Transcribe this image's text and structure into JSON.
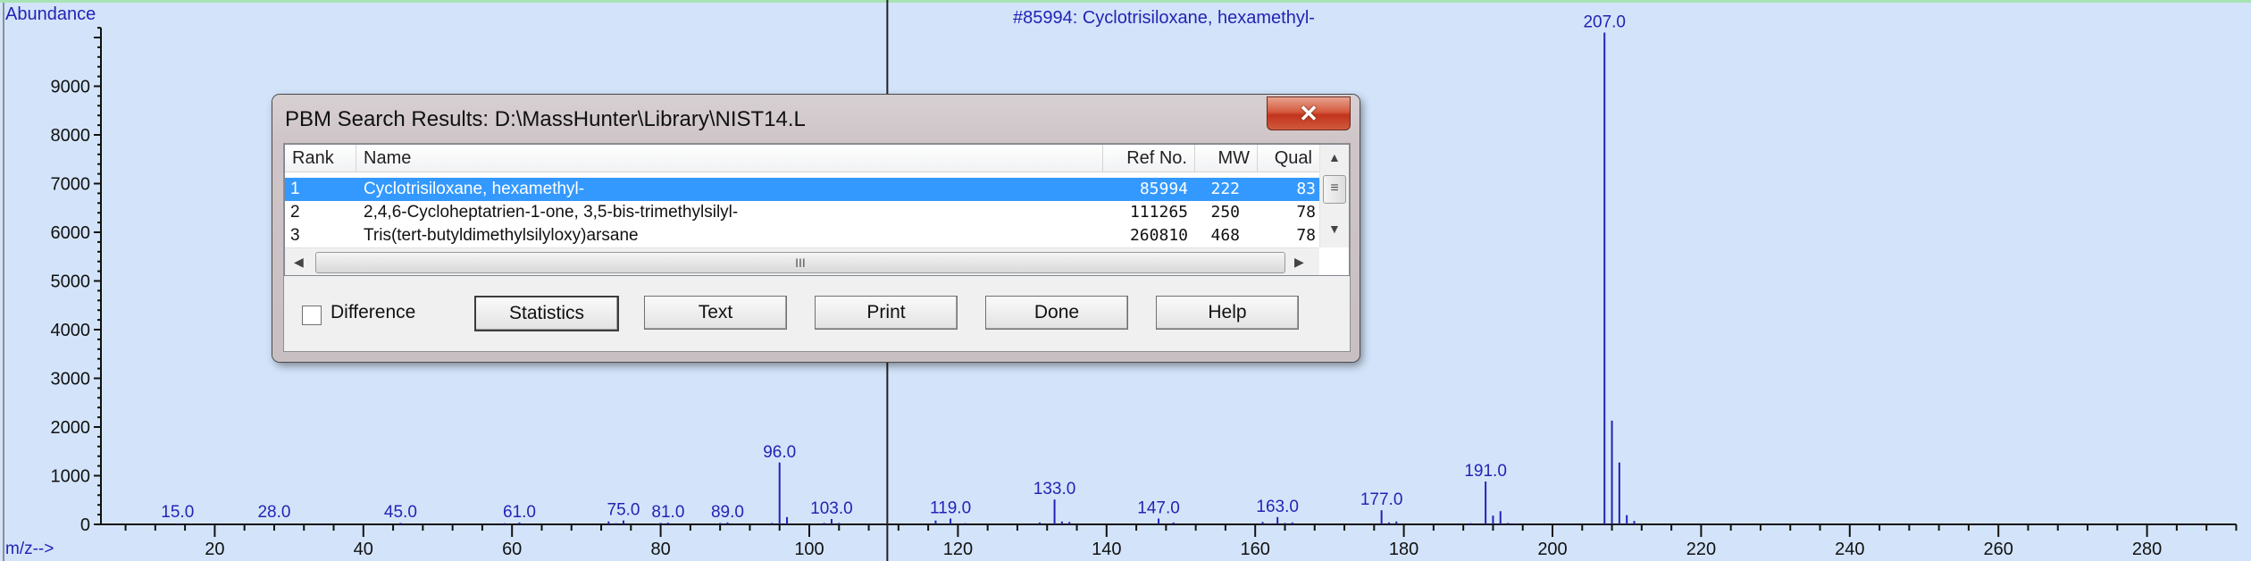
{
  "chart_data": {
    "type": "bar",
    "title": "#85994: Cyclotrisiloxane, hexamethyl-",
    "ylabel": "Abundance",
    "xlabel": "m/z-->",
    "xlim": [
      5,
      292
    ],
    "ylim": [
      0,
      10200
    ],
    "xticks": [
      20,
      40,
      60,
      80,
      100,
      120,
      140,
      160,
      180,
      200,
      220,
      240,
      260,
      280
    ],
    "yticks": [
      0,
      1000,
      2000,
      3000,
      4000,
      5000,
      6000,
      7000,
      8000,
      9000
    ],
    "cursor_mz": 110.5,
    "peaks": [
      {
        "mz": 15,
        "abundance": 20
      },
      {
        "mz": 28,
        "abundance": 15
      },
      {
        "mz": 45,
        "abundance": 30
      },
      {
        "mz": 59,
        "abundance": 25
      },
      {
        "mz": 61,
        "abundance": 40
      },
      {
        "mz": 73,
        "abundance": 60
      },
      {
        "mz": 74,
        "abundance": 25
      },
      {
        "mz": 75,
        "abundance": 80
      },
      {
        "mz": 80,
        "abundance": 30
      },
      {
        "mz": 81,
        "abundance": 35
      },
      {
        "mz": 88,
        "abundance": 30
      },
      {
        "mz": 89,
        "abundance": 40
      },
      {
        "mz": 95,
        "abundance": 30
      },
      {
        "mz": 96,
        "abundance": 1270
      },
      {
        "mz": 97,
        "abundance": 150
      },
      {
        "mz": 102,
        "abundance": 30
      },
      {
        "mz": 103,
        "abundance": 110
      },
      {
        "mz": 104,
        "abundance": 30
      },
      {
        "mz": 117,
        "abundance": 80
      },
      {
        "mz": 119,
        "abundance": 120
      },
      {
        "mz": 121,
        "abundance": 25
      },
      {
        "mz": 131,
        "abundance": 40
      },
      {
        "mz": 133,
        "abundance": 510
      },
      {
        "mz": 134,
        "abundance": 60
      },
      {
        "mz": 135,
        "abundance": 50
      },
      {
        "mz": 147,
        "abundance": 120
      },
      {
        "mz": 149,
        "abundance": 40
      },
      {
        "mz": 161,
        "abundance": 50
      },
      {
        "mz": 162,
        "abundance": 20
      },
      {
        "mz": 163,
        "abundance": 150
      },
      {
        "mz": 164,
        "abundance": 30
      },
      {
        "mz": 165,
        "abundance": 40
      },
      {
        "mz": 177,
        "abundance": 290
      },
      {
        "mz": 178,
        "abundance": 40
      },
      {
        "mz": 179,
        "abundance": 60
      },
      {
        "mz": 189,
        "abundance": 25
      },
      {
        "mz": 191,
        "abundance": 880
      },
      {
        "mz": 192,
        "abundance": 180
      },
      {
        "mz": 193,
        "abundance": 270
      },
      {
        "mz": 194,
        "abundance": 30
      },
      {
        "mz": 195,
        "abundance": 20
      },
      {
        "mz": 207,
        "abundance": 10100
      },
      {
        "mz": 208,
        "abundance": 2130
      },
      {
        "mz": 209,
        "abundance": 1270
      },
      {
        "mz": 210,
        "abundance": 190
      },
      {
        "mz": 211,
        "abundance": 70
      }
    ],
    "peak_labels": [
      {
        "mz": 15,
        "text": "15.0"
      },
      {
        "mz": 28,
        "text": "28.0"
      },
      {
        "mz": 45,
        "text": "45.0"
      },
      {
        "mz": 61,
        "text": "61.0"
      },
      {
        "mz": 75,
        "text": "75.0"
      },
      {
        "mz": 81,
        "text": "81.0"
      },
      {
        "mz": 89,
        "text": "89.0"
      },
      {
        "mz": 96,
        "text": "96.0"
      },
      {
        "mz": 103,
        "text": "103.0"
      },
      {
        "mz": 119,
        "text": "119.0"
      },
      {
        "mz": 133,
        "text": "133.0"
      },
      {
        "mz": 147,
        "text": "147.0"
      },
      {
        "mz": 163,
        "text": "163.0"
      },
      {
        "mz": 177,
        "text": "177.0"
      },
      {
        "mz": 191,
        "text": "191.0"
      },
      {
        "mz": 207,
        "text": "207.0"
      }
    ],
    "colors": {
      "peak": "#2323b4",
      "axis": "#111111",
      "background": "#d3e4fa"
    }
  },
  "dialog": {
    "title": "PBM Search Results: D:\\MassHunter\\Library\\NIST14.L",
    "close_glyph": "✕",
    "columns": [
      "Rank",
      "Name",
      "Ref No.",
      "MW",
      "Qual"
    ],
    "rows": [
      {
        "rank": "1",
        "name": "Cyclotrisiloxane, hexamethyl-",
        "ref": "85994",
        "mw": "222",
        "qual": "83",
        "selected": true
      },
      {
        "rank": "2",
        "name": "2,4,6-Cycloheptatrien-1-one, 3,5-bis-trimethylsilyl-",
        "ref": "111265",
        "mw": "250",
        "qual": "78"
      },
      {
        "rank": "3",
        "name": "Tris(tert-butyldimethylsilyloxy)arsane",
        "ref": "260810",
        "mw": "468",
        "qual": "78"
      }
    ],
    "difference_label": "Difference",
    "difference_checked": false,
    "buttons": {
      "statistics": "Statistics",
      "text": "Text",
      "print": "Print",
      "done": "Done",
      "help": "Help"
    },
    "scroll": {
      "up": "▲",
      "down": "▼",
      "left": "◀",
      "right": "▶",
      "grip_h": "III",
      "grip_v": "≡"
    },
    "selection_color": "#3399ff"
  }
}
